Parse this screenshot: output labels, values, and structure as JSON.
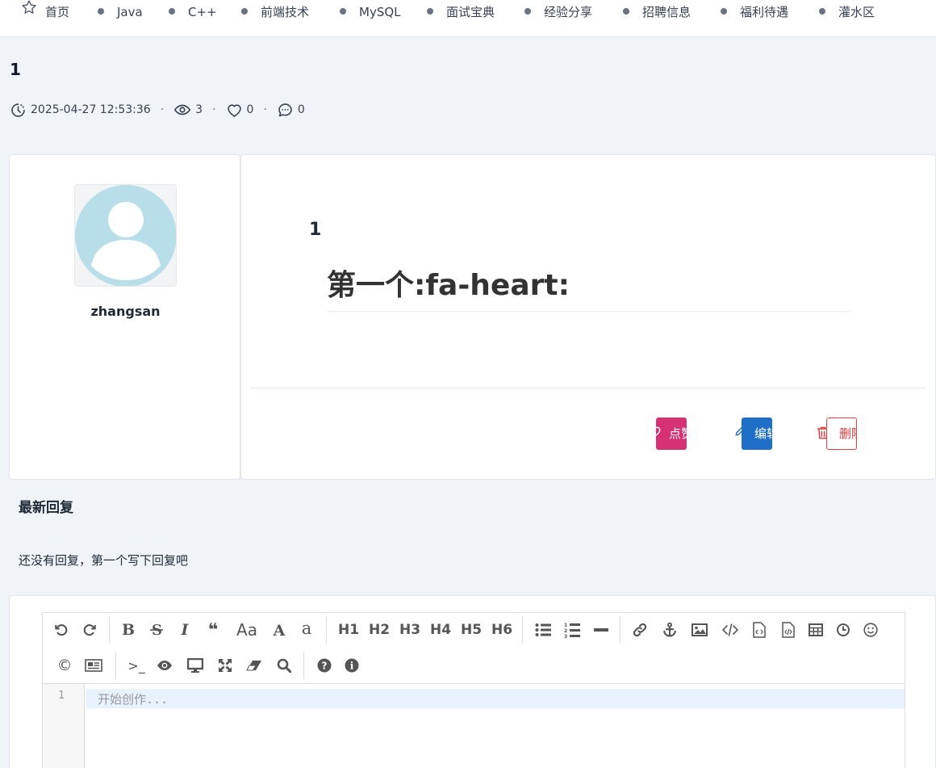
{
  "nav": {
    "home": "首页",
    "items": [
      "Java",
      "C++",
      "前端技术",
      "MySQL",
      "面试宝典",
      "经验分享",
      "招聘信息",
      "福利待遇",
      "灌水区"
    ]
  },
  "post": {
    "title": "1",
    "timestamp": "2025-04-27 12:53:36",
    "views": "3",
    "likes": "0",
    "comments": "0",
    "meta_separator": "·"
  },
  "author": {
    "name": "zhangsan"
  },
  "content": {
    "paragraph": "1",
    "heading": "第一个:fa-heart:"
  },
  "actions": {
    "like": "点赞",
    "edit": "编辑",
    "delete": "删除"
  },
  "replies": {
    "title": "最新回复",
    "empty": "还没有回复，第一个写下回复吧"
  },
  "editor": {
    "line_number": "1",
    "placeholder": "开始创作...",
    "toolbar_text": {
      "bold": "B",
      "italic": "I",
      "quote": "❝",
      "case": "Aa",
      "upper": "A",
      "lower": "a",
      "h1": "H1",
      "h2": "H2",
      "h3": "H3",
      "h4": "H4",
      "h5": "H5",
      "h6": "H6",
      "copyright": "©",
      "terminal": ">_"
    }
  },
  "colors": {
    "like_button": "#d63172",
    "edit_button": "#1f6fc8",
    "delete_button": "#e53e3e",
    "avatar": "#b8dfe9",
    "page_bg": "#f0f3f8"
  }
}
